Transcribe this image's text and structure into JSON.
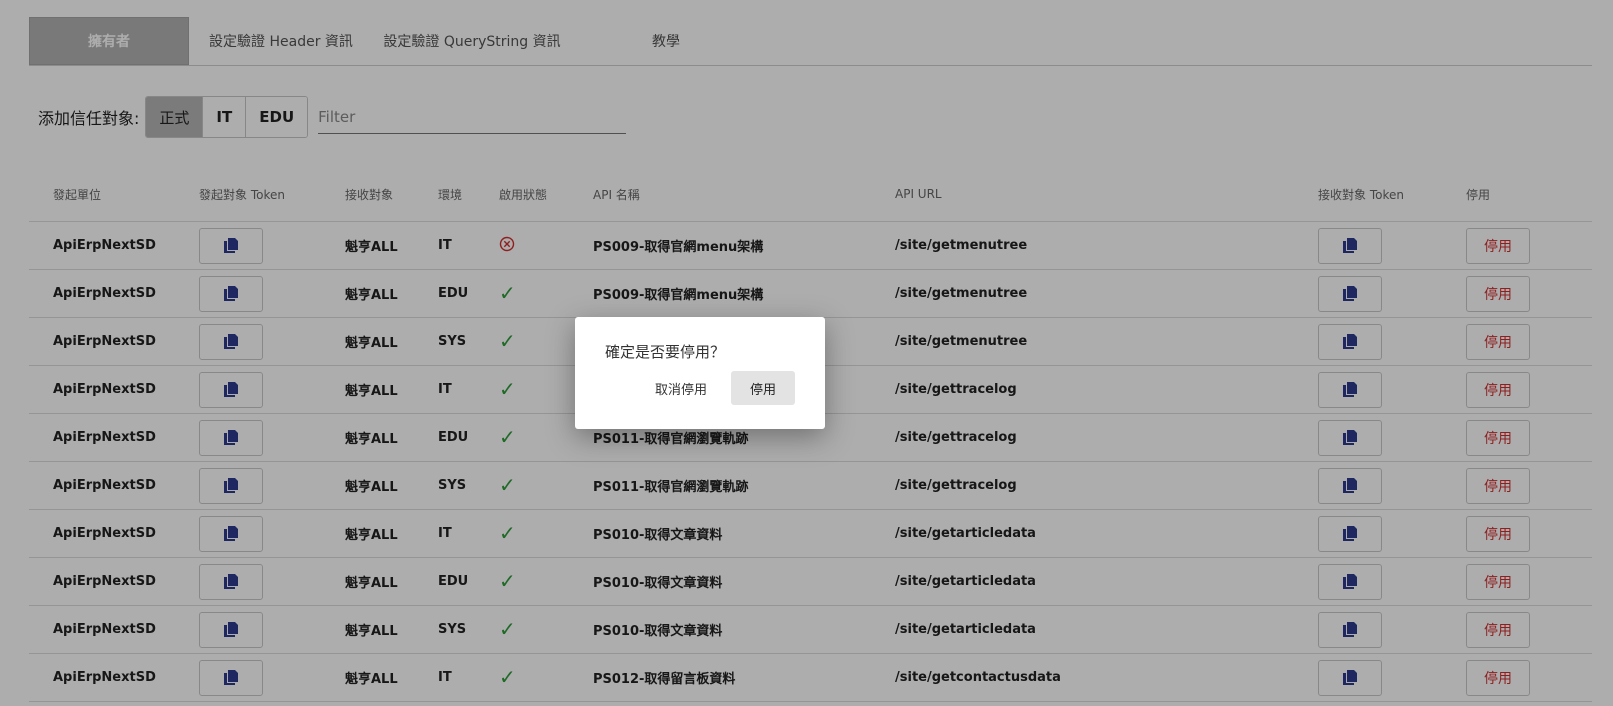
{
  "tabs": [
    {
      "label": "擁有者"
    },
    {
      "label": "設定驗證 Header 資訊"
    },
    {
      "label": "設定驗證 QueryString 資訊"
    },
    {
      "label": "教學"
    }
  ],
  "filter": {
    "label": "添加信任對象:",
    "segments": [
      "正式",
      "IT",
      "EDU"
    ],
    "selected": "正式",
    "placeholder": "Filter",
    "value": ""
  },
  "table": {
    "headers": [
      "發起單位",
      "發起對象 Token",
      "接收對象",
      "環境",
      "啟用狀態",
      "API 名稱",
      "API URL",
      "接收對象 Token",
      "停用"
    ],
    "disable_label": "停用",
    "rows": [
      {
        "unit": "ApiErpNextSD",
        "receiver": "魁亨ALL",
        "env": "IT",
        "status": "disabled",
        "api_name": "PS009-取得官網menu架構",
        "api_url": "/site/getmenutree"
      },
      {
        "unit": "ApiErpNextSD",
        "receiver": "魁亨ALL",
        "env": "EDU",
        "status": "enabled",
        "api_name": "PS009-取得官網menu架構",
        "api_url": "/site/getmenutree"
      },
      {
        "unit": "ApiErpNextSD",
        "receiver": "魁亨ALL",
        "env": "SYS",
        "status": "enabled",
        "api_name": "",
        "api_url": "/site/getmenutree"
      },
      {
        "unit": "ApiErpNextSD",
        "receiver": "魁亨ALL",
        "env": "IT",
        "status": "enabled",
        "api_name": "",
        "api_url": "/site/gettracelog"
      },
      {
        "unit": "ApiErpNextSD",
        "receiver": "魁亨ALL",
        "env": "EDU",
        "status": "enabled",
        "api_name": "PS011-取得官網瀏覽軌跡",
        "api_url": "/site/gettracelog"
      },
      {
        "unit": "ApiErpNextSD",
        "receiver": "魁亨ALL",
        "env": "SYS",
        "status": "enabled",
        "api_name": "PS011-取得官網瀏覽軌跡",
        "api_url": "/site/gettracelog"
      },
      {
        "unit": "ApiErpNextSD",
        "receiver": "魁亨ALL",
        "env": "IT",
        "status": "enabled",
        "api_name": "PS010-取得文章資料",
        "api_url": "/site/getarticledata"
      },
      {
        "unit": "ApiErpNextSD",
        "receiver": "魁亨ALL",
        "env": "EDU",
        "status": "enabled",
        "api_name": "PS010-取得文章資料",
        "api_url": "/site/getarticledata"
      },
      {
        "unit": "ApiErpNextSD",
        "receiver": "魁亨ALL",
        "env": "SYS",
        "status": "enabled",
        "api_name": "PS010-取得文章資料",
        "api_url": "/site/getarticledata"
      },
      {
        "unit": "ApiErpNextSD",
        "receiver": "魁亨ALL",
        "env": "IT",
        "status": "enabled",
        "api_name": "PS012-取得留言板資料",
        "api_url": "/site/getcontactusdata"
      }
    ]
  },
  "dialog": {
    "message": "確定是否要停用？",
    "cancel_label": "取消停用",
    "confirm_label": "停用"
  },
  "colors": {
    "status_ok": "#2e9b3a",
    "status_off": "#d32f2f",
    "disable_text": "#d32f2f",
    "copy_icon": "#2f3a8f",
    "active_tab": "#b3b3b3"
  },
  "icons": {
    "copy": "copy-icon",
    "enabled": "check-icon",
    "disabled": "circle-x-icon"
  }
}
